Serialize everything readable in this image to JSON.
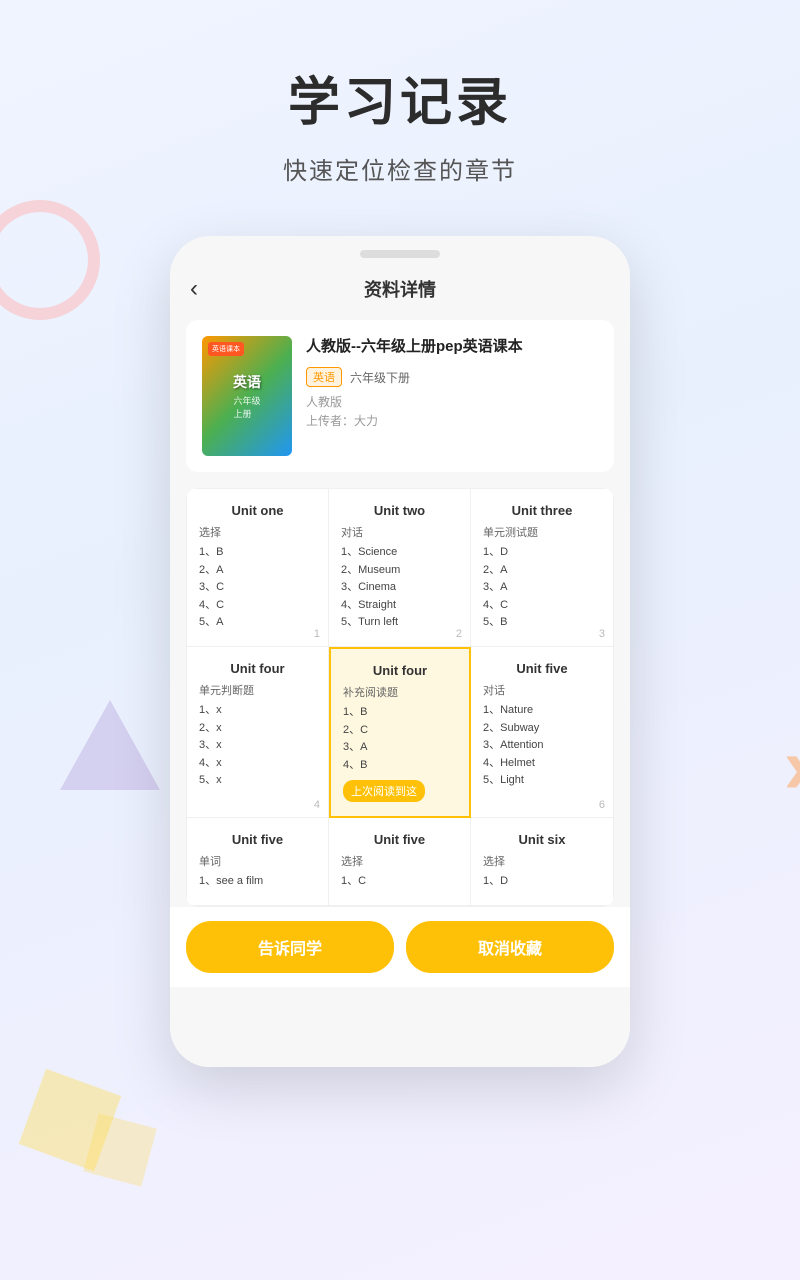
{
  "page": {
    "title": "学习记录",
    "subtitle": "快速定位检查的章节"
  },
  "header": {
    "back_icon": "‹",
    "title": "资料详情"
  },
  "book": {
    "cover_title": "英语",
    "cover_sub": "六年级\n上册",
    "cover_badge": "英语课本",
    "name": "人教版--六年级上册pep英语课本",
    "tag_subject": "英语",
    "tag_grade": "六年级下册",
    "publisher": "人教版",
    "uploader": "上传者：大力"
  },
  "units": [
    {
      "name": "Unit one",
      "type": "选择",
      "items": [
        "1、B",
        "2、A",
        "3、C",
        "4、C",
        "5、A"
      ],
      "number": "1",
      "highlighted": false,
      "last_read": false
    },
    {
      "name": "Unit two",
      "type": "对话",
      "items": [
        "1、Science",
        "2、Museum",
        "3、Cinema",
        "4、Straight",
        "5、Turn left"
      ],
      "number": "2",
      "highlighted": false,
      "last_read": false
    },
    {
      "name": "Unit three",
      "type": "单元测试题",
      "items": [
        "1、D",
        "2、A",
        "3、A",
        "4、C",
        "5、B"
      ],
      "number": "3",
      "highlighted": false,
      "last_read": false
    },
    {
      "name": "Unit four",
      "type": "单元判断题",
      "items": [
        "1、x",
        "2、x",
        "3、x",
        "4、x",
        "5、x"
      ],
      "number": "4",
      "highlighted": false,
      "last_read": false
    },
    {
      "name": "Unit four",
      "type": "补充阅读题",
      "items": [
        "1、B",
        "2、C",
        "3、A",
        "4、B"
      ],
      "number": "",
      "highlighted": true,
      "last_read": true,
      "last_read_label": "上次阅读到这"
    },
    {
      "name": "Unit five",
      "type": "对话",
      "items": [
        "1、Nature",
        "2、Subway",
        "3、Attention",
        "4、Helmet",
        "5、Light"
      ],
      "number": "6",
      "highlighted": false,
      "last_read": false
    },
    {
      "name": "Unit five",
      "type": "单词",
      "items": [
        "1、see a film"
      ],
      "number": "",
      "highlighted": false,
      "last_read": false
    },
    {
      "name": "Unit five",
      "type": "选择",
      "items": [
        "1、C"
      ],
      "number": "",
      "highlighted": false,
      "last_read": false
    },
    {
      "name": "Unit six",
      "type": "选择",
      "items": [
        "1、D"
      ],
      "number": "",
      "highlighted": false,
      "last_read": false
    }
  ],
  "buttons": {
    "tell": "告诉同学",
    "uncollect": "取消收藏"
  }
}
